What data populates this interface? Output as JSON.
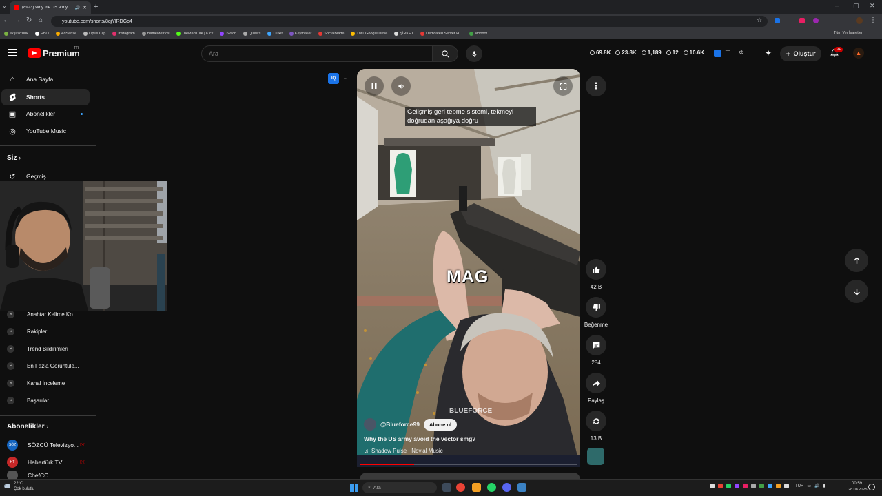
{
  "browser": {
    "tab_title": "(8923) Why the US army a...",
    "url": "youtube.com/shorts/8qjYlRDGo4",
    "new_tab": "+",
    "window_controls": [
      "–",
      "▢",
      "✕"
    ],
    "bookmarks": [
      {
        "label": "ekşi sözlük",
        "color": "#7cb342"
      },
      {
        "label": "HBO",
        "color": "#ffffff"
      },
      {
        "label": "AdSense",
        "color": "#f9ab00"
      },
      {
        "label": "Opus Clip",
        "color": "#bbbbbb"
      },
      {
        "label": "Instagram",
        "color": "#e1306c"
      },
      {
        "label": "BattleMetrics",
        "color": "#999999"
      },
      {
        "label": "TheMadTurk | Kick",
        "color": "#53fc18"
      },
      {
        "label": "Twitch",
        "color": "#9146ff"
      },
      {
        "label": "Quests",
        "color": "#aaaaaa"
      },
      {
        "label": "Lurkit",
        "color": "#3ea6ff"
      },
      {
        "label": "Keymailer",
        "color": "#7e57c2"
      },
      {
        "label": "SocialBlade",
        "color": "#e53935"
      },
      {
        "label": "TMT Google Drive",
        "color": "#fbbc04"
      },
      {
        "label": "ŞİRKET",
        "color": "#dddddd"
      },
      {
        "label": "Dedicated Server H...",
        "color": "#e53935"
      },
      {
        "label": "Moobot",
        "color": "#43a047"
      }
    ],
    "all_bookmarks": "Tüm Yer İşaretleri"
  },
  "header": {
    "logo_text": "Premium",
    "country_code": "TR",
    "search_placeholder": "Ara",
    "stats": [
      {
        "value": "69.8K",
        "icon": "eye-clock-icon"
      },
      {
        "value": "23.8K",
        "icon": "person-icon"
      },
      {
        "value": "1,189",
        "icon": "chat-icon"
      },
      {
        "value": "12",
        "icon": "people-icon"
      },
      {
        "value": "10.6K",
        "icon": "eye-icon"
      }
    ],
    "create_label": "Oluştur",
    "notification_count": "9+"
  },
  "sidebar": {
    "main": [
      {
        "label": "Ana Sayfa",
        "icon": "home-icon"
      },
      {
        "label": "Shorts",
        "icon": "shorts-icon"
      },
      {
        "label": "Abonelikler",
        "icon": "subscriptions-icon"
      },
      {
        "label": "YouTube Music",
        "icon": "music-icon"
      }
    ],
    "siz_label": "Siz",
    "history_label": "Geçmiş",
    "extensions": [
      "Anahtar Kelime Ko...",
      "Rakipler",
      "Trend Bildirimleri",
      "En Fazla Görüntüle...",
      "Kanal İnceleme",
      "Başarılar"
    ],
    "subscriptions_label": "Abonelikler",
    "subscriptions": [
      {
        "label": "SÖZCÜ Televizyo...",
        "color": "#1565c0"
      },
      {
        "label": "Habertürk TV",
        "color": "#c62828"
      },
      {
        "label": "ChefCC",
        "color": "#555555"
      }
    ]
  },
  "short": {
    "iq_chip": "IQ",
    "caption": "Gelişmiş geri tepme sistemi, tekmeyi doğrudan aşağıya doğru",
    "overlay_text": "MAG",
    "watermark": "BLUEFORCE",
    "channel": "@Blueforce99",
    "subscribe_label": "Abone ol",
    "title": "Why the US army avoid the vector smg?",
    "music": "Shadow Pulse · Novial Music",
    "progress": 0.25
  },
  "actions": {
    "like_count": "42 B",
    "dislike_label": "Beğenme",
    "comment_count": "284",
    "share_label": "Paylaş",
    "remix_count": "13 B"
  },
  "taskbar": {
    "temperature": "22°C",
    "weather": "Çok bulutlu",
    "search_placeholder": "Ara",
    "language": "TUR",
    "time": "00:59",
    "date": "28.08.2025"
  }
}
